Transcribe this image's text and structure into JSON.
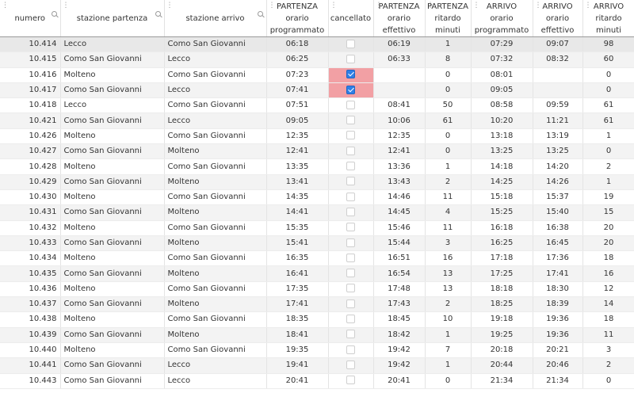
{
  "columns": [
    {
      "key": "numero",
      "label": "numero"
    },
    {
      "key": "partenza",
      "label": "stazione partenza"
    },
    {
      "key": "arrivo",
      "label": "stazione arrivo"
    },
    {
      "key": "part_prog",
      "label": "PARTENZA\norario\nprogrammato"
    },
    {
      "key": "cancellato",
      "label": "cancellato"
    },
    {
      "key": "part_eff",
      "label": "PARTENZA\norario\neffettivo"
    },
    {
      "key": "part_rit",
      "label": "PARTENZA\nritardo\nminuti"
    },
    {
      "key": "arr_prog",
      "label": "ARRIVO\norario\nprogrammato"
    },
    {
      "key": "arr_eff",
      "label": "ARRIVO\norario\neffettivo"
    },
    {
      "key": "arr_rit",
      "label": "ARRIVO\nritardo\nminuti"
    }
  ],
  "rows": [
    [
      "10.414",
      "Lecco",
      "Como San Giovanni",
      "06:18",
      false,
      "06:19",
      "1",
      "07:29",
      "09:07",
      "98"
    ],
    [
      "10.415",
      "Como San Giovanni",
      "Lecco",
      "06:25",
      false,
      "06:33",
      "8",
      "07:32",
      "08:32",
      "60"
    ],
    [
      "10.416",
      "Molteno",
      "Como San Giovanni",
      "07:23",
      true,
      "",
      "0",
      "08:01",
      "",
      "0"
    ],
    [
      "10.417",
      "Como San Giovanni",
      "Lecco",
      "07:41",
      true,
      "",
      "0",
      "09:05",
      "",
      "0"
    ],
    [
      "10.418",
      "Lecco",
      "Como San Giovanni",
      "07:51",
      false,
      "08:41",
      "50",
      "08:58",
      "09:59",
      "61"
    ],
    [
      "10.421",
      "Como San Giovanni",
      "Lecco",
      "09:05",
      false,
      "10:06",
      "61",
      "10:20",
      "11:21",
      "61"
    ],
    [
      "10.426",
      "Molteno",
      "Como San Giovanni",
      "12:35",
      false,
      "12:35",
      "0",
      "13:18",
      "13:19",
      "1"
    ],
    [
      "10.427",
      "Como San Giovanni",
      "Molteno",
      "12:41",
      false,
      "12:41",
      "0",
      "13:25",
      "13:25",
      "0"
    ],
    [
      "10.428",
      "Molteno",
      "Como San Giovanni",
      "13:35",
      false,
      "13:36",
      "1",
      "14:18",
      "14:20",
      "2"
    ],
    [
      "10.429",
      "Como San Giovanni",
      "Molteno",
      "13:41",
      false,
      "13:43",
      "2",
      "14:25",
      "14:26",
      "1"
    ],
    [
      "10.430",
      "Molteno",
      "Como San Giovanni",
      "14:35",
      false,
      "14:46",
      "11",
      "15:18",
      "15:37",
      "19"
    ],
    [
      "10.431",
      "Como San Giovanni",
      "Molteno",
      "14:41",
      false,
      "14:45",
      "4",
      "15:25",
      "15:40",
      "15"
    ],
    [
      "10.432",
      "Molteno",
      "Como San Giovanni",
      "15:35",
      false,
      "15:46",
      "11",
      "16:18",
      "16:38",
      "20"
    ],
    [
      "10.433",
      "Como San Giovanni",
      "Molteno",
      "15:41",
      false,
      "15:44",
      "3",
      "16:25",
      "16:45",
      "20"
    ],
    [
      "10.434",
      "Molteno",
      "Como San Giovanni",
      "16:35",
      false,
      "16:51",
      "16",
      "17:18",
      "17:36",
      "18"
    ],
    [
      "10.435",
      "Como San Giovanni",
      "Molteno",
      "16:41",
      false,
      "16:54",
      "13",
      "17:25",
      "17:41",
      "16"
    ],
    [
      "10.436",
      "Molteno",
      "Como San Giovanni",
      "17:35",
      false,
      "17:48",
      "13",
      "18:18",
      "18:30",
      "12"
    ],
    [
      "10.437",
      "Como San Giovanni",
      "Molteno",
      "17:41",
      false,
      "17:43",
      "2",
      "18:25",
      "18:39",
      "14"
    ],
    [
      "10.438",
      "Molteno",
      "Como San Giovanni",
      "18:35",
      false,
      "18:45",
      "10",
      "19:18",
      "19:36",
      "18"
    ],
    [
      "10.439",
      "Como San Giovanni",
      "Molteno",
      "18:41",
      false,
      "18:42",
      "1",
      "19:25",
      "19:36",
      "11"
    ],
    [
      "10.440",
      "Molteno",
      "Como San Giovanni",
      "19:35",
      false,
      "19:42",
      "7",
      "20:18",
      "20:21",
      "3"
    ],
    [
      "10.441",
      "Como San Giovanni",
      "Lecco",
      "19:41",
      false,
      "19:42",
      "1",
      "20:44",
      "20:46",
      "2"
    ],
    [
      "10.443",
      "Como San Giovanni",
      "Lecco",
      "20:41",
      false,
      "20:41",
      "0",
      "21:34",
      "21:34",
      "0"
    ]
  ]
}
